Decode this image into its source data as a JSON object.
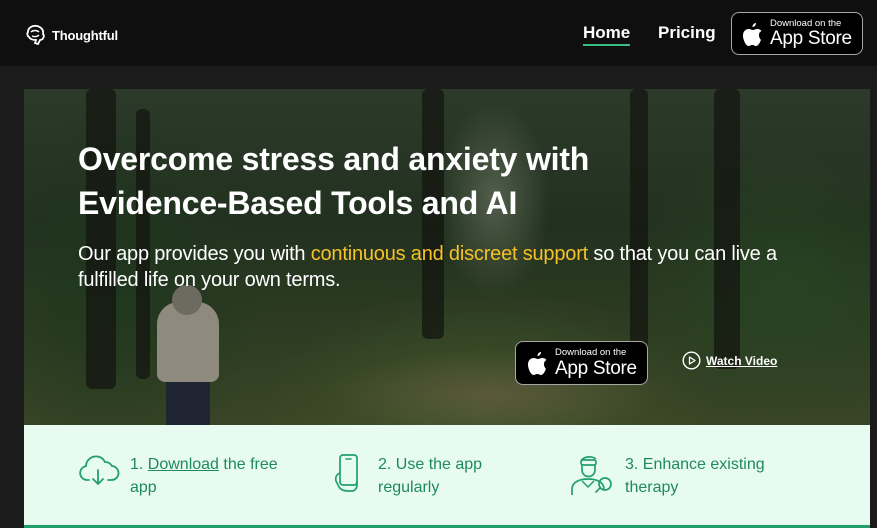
{
  "brand": {
    "name": "Thoughtful",
    "icon": "brain-logo-icon"
  },
  "nav": {
    "home": "Home",
    "pricing": "Pricing"
  },
  "appstore": {
    "small": "Download on the",
    "big": "App Store",
    "icon": "apple-icon"
  },
  "hero": {
    "title_line1": "Overcome stress and anxiety with",
    "title_line2": "Evidence-Based Tools and AI",
    "sub_before": "Our app provides you with ",
    "sub_highlight": "continuous and discreet support",
    "sub_after": " so that you can live a fulfilled life on your own terms.",
    "watch_video": "Watch Video"
  },
  "steps": [
    {
      "num": "1.",
      "link": "Download",
      "rest": " the free app",
      "icon": "cloud-download-icon"
    },
    {
      "text": "2. Use the app regularly",
      "icon": "phone-hand-icon"
    },
    {
      "text": "3. Enhance existing therapy",
      "icon": "therapist-icon"
    }
  ],
  "colors": {
    "accent": "#22a06b",
    "highlight": "#f5c227",
    "steps_bg": "#e7fbf1"
  }
}
